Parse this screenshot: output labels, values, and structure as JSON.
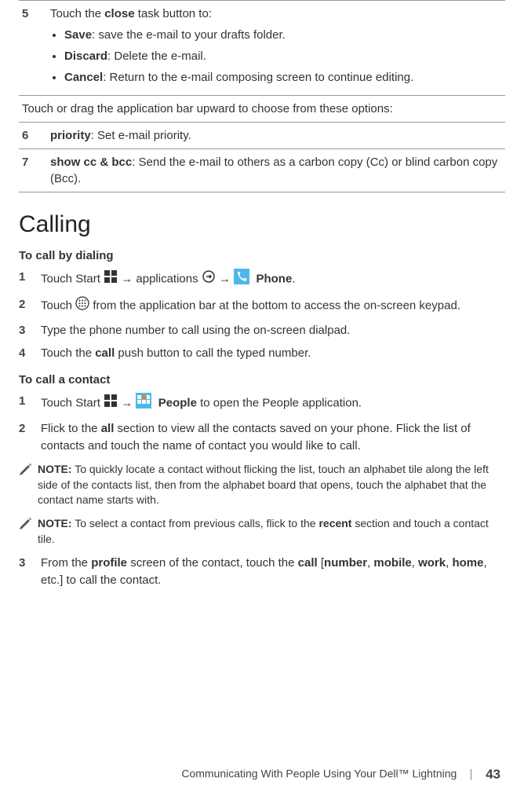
{
  "table": {
    "row5": {
      "num": "5",
      "lead": "Touch the ",
      "bold": "close",
      "trail": " task button to:",
      "bullets": [
        {
          "b": "Save",
          "t": ": save the e-mail to your drafts folder."
        },
        {
          "b": "Discard",
          "t": ": Delete the e-mail."
        },
        {
          "b": "Cancel",
          "t": ": Return to the e-mail composing screen to continue editing."
        }
      ]
    },
    "touch_drag": "Touch or drag the application bar upward to choose from these options:",
    "row6": {
      "num": "6",
      "b": "priority",
      "t": ": Set e-mail priority."
    },
    "row7": {
      "num": "7",
      "b": "show cc & bcc",
      "t": ": Send the e-mail to others as a carbon copy (Cc) or blind carbon copy (Bcc)."
    }
  },
  "heading": "Calling",
  "section_dialing": {
    "title": "To call by dialing",
    "step1": {
      "num": "1",
      "p1": "Touch Start ",
      "arrow1": "→",
      "p2": " applications ",
      "arrow2": "→",
      "p3": " ",
      "bold": "Phone",
      "p4": "."
    },
    "step2": {
      "num": "2",
      "p1": "Touch ",
      "p2": " from the application bar at the bottom to access the on-screen keypad."
    },
    "step3": {
      "num": "3",
      "text": "Type the phone number to call using the on-screen dialpad."
    },
    "step4": {
      "num": "4",
      "p1": "Touch the ",
      "b": "call",
      "p2": " push button to call the typed number."
    }
  },
  "section_contact": {
    "title": "To call a contact",
    "step1": {
      "num": "1",
      "p1": "Touch Start ",
      "arrow": "→",
      "p2": " ",
      "b": "People",
      "p3": " to open the People application."
    },
    "step2": {
      "num": "2",
      "p1": "Flick to the ",
      "b": "all",
      "p2": " section to view all the contacts saved on your phone. Flick the list of contacts and touch the name of contact you would like to call."
    },
    "note1": {
      "label": "NOTE:",
      "text": " To quickly locate a contact without flicking the list, touch an alphabet tile along the left side of the contacts list, then from the alphabet board that opens, touch the alphabet that the contact name starts with."
    },
    "note2": {
      "label": "NOTE:",
      "p1": " To select a contact from previous calls, flick to the ",
      "b": "recent",
      "p2": " section and touch a contact tile."
    },
    "step3": {
      "num": "3",
      "p1": "From the ",
      "b1": "profile",
      "p2": " screen of the contact, touch the ",
      "b2": "call",
      "p3": " [",
      "b3": "number",
      "p4": ", ",
      "b4": "mobile",
      "p5": ", ",
      "b5": "work",
      "p6": ", ",
      "b6": "home",
      "p7": ", etc.] to call the contact."
    }
  },
  "footer": {
    "text": "Communicating With People Using Your Dell™ Lightning",
    "page": "43"
  }
}
